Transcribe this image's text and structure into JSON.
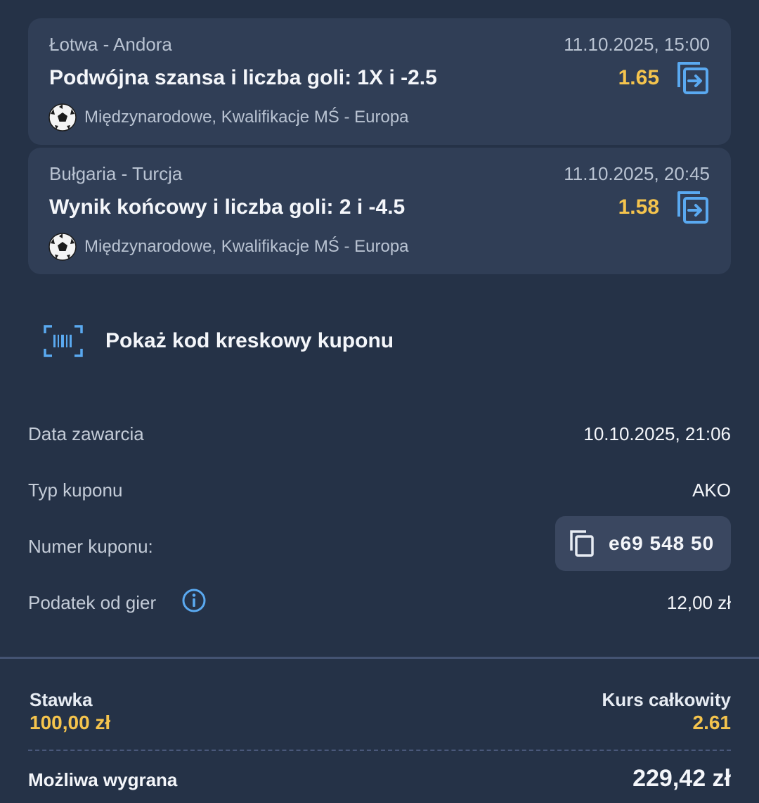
{
  "bets": [
    {
      "teams": "Łotwa - Andora",
      "datetime": "11.10.2025, 15:00",
      "market": "Podwójna szansa i liczba goli: 1X i -2.5",
      "odd": "1.65",
      "league": "Międzynarodowe, Kwalifikacje MŚ - Europa",
      "icons": {
        "sport": "soccer-ball-icon",
        "action": "copy-bet-icon"
      }
    },
    {
      "teams": "Bułgaria - Turcja",
      "datetime": "11.10.2025, 20:45",
      "market": "Wynik końcowy i liczba goli: 2 i -4.5",
      "odd": "1.58",
      "league": "Międzynarodowe, Kwalifikacje MŚ - Europa",
      "icons": {
        "sport": "soccer-ball-icon",
        "action": "copy-bet-icon"
      }
    }
  ],
  "barcode": {
    "label": "Pokaż kod kreskowy kuponu",
    "icon": "barcode-scan-icon"
  },
  "details": {
    "date_label": "Data zawarcia",
    "date_value": "10.10.2025, 21:06",
    "type_label": "Typ kuponu",
    "type_value": "AKO",
    "number_label": "Numer kuponu:",
    "number_value": "e69 548 50",
    "tax_label": "Podatek od gier",
    "tax_value": "12,00 zł"
  },
  "summary": {
    "stake_label": "Stawka",
    "stake_value": "100,00 zł",
    "total_odds_label": "Kurs całkowity",
    "total_odds_value": "2.61",
    "win_label": "Możliwa wygrana",
    "win_value": "229,42 zł"
  },
  "colors": {
    "background": "#253247",
    "card": "#303e56",
    "accent_yellow": "#f5c44d",
    "accent_blue": "#5aa9f0"
  }
}
